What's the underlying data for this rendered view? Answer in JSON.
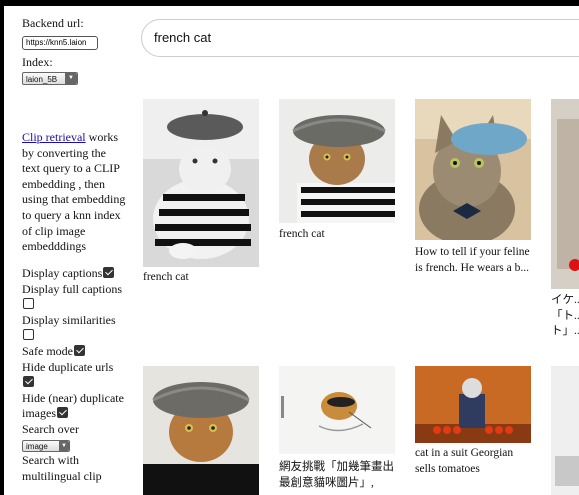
{
  "sidebar": {
    "backend_label": "Backend url:",
    "backend_value": "https://knn5.laion",
    "index_label": "Index:",
    "index_value": "laion_5B",
    "description_link": "Clip retrieval",
    "description_rest": " works by converting the text query to a CLIP embedding , then using that embedding to query a knn index of clip image embedddings",
    "options": {
      "display_captions": "Display captions",
      "display_full": "Display full captions",
      "display_similarities": "Display similarities",
      "safe_mode": "Safe mode",
      "hide_dup_urls": "Hide duplicate urls",
      "hide_near_dup": "Hide (near) duplicate images",
      "search_over": "Search over",
      "search_over_value": "image",
      "multilingual": "Search with multilingual clip"
    },
    "checked": {
      "display_captions": true,
      "display_full": false,
      "display_similarities": false,
      "safe_mode": true,
      "hide_dup_urls": true,
      "hide_near_dup": true
    }
  },
  "search": {
    "query": "french cat"
  },
  "results": [
    {
      "caption": "french cat"
    },
    {
      "caption": "french cat"
    },
    {
      "caption": "How to tell if your feline is french. He wears a b..."
    },
    {
      "caption": "イケ...「ト...ト」...NAVE"
    },
    {
      "caption": ""
    },
    {
      "caption": "網友挑戰「加幾筆畫出最創意貓咪圖片」,"
    },
    {
      "caption": "cat in a suit Georgian sells tomatoes"
    },
    {
      "caption": ""
    }
  ],
  "colors": {
    "link": "#1a0dab",
    "frame": "#000000",
    "border": "#cccccc"
  },
  "icons": [
    "checkbox-checked",
    "checkbox-empty",
    "dropdown-arrow"
  ]
}
